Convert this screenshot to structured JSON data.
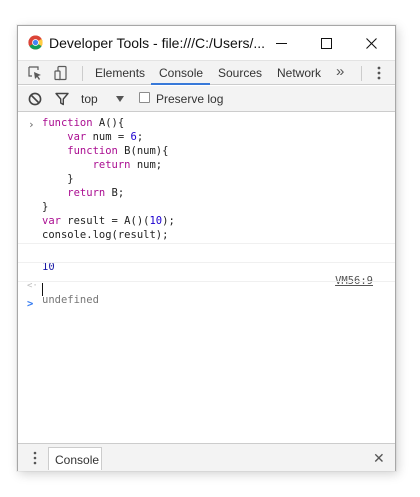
{
  "window": {
    "title": "Developer Tools - file:///C:/Users/...",
    "controls": {
      "minimize": "—",
      "maximize": "☐",
      "close": "✕"
    }
  },
  "tabs": {
    "items": [
      {
        "label": "Elements",
        "active": false
      },
      {
        "label": "Console",
        "active": true
      },
      {
        "label": "Sources",
        "active": false
      },
      {
        "label": "Network",
        "active": false
      }
    ],
    "more_label": "»"
  },
  "filter": {
    "context": "top",
    "preserve_log": "Preserve log"
  },
  "console": {
    "input_code": [
      [
        [
          "kw",
          "function"
        ],
        [
          "plain",
          " A(){"
        ]
      ],
      [
        [
          "kw",
          "    var"
        ],
        [
          "plain",
          " num = "
        ],
        [
          "num",
          "6"
        ],
        [
          "plain",
          ";"
        ]
      ],
      [
        [
          "kw",
          "    function"
        ],
        [
          "plain",
          " B(num){"
        ]
      ],
      [
        [
          "kw",
          "        return"
        ],
        [
          "plain",
          " num;"
        ]
      ],
      [
        [
          "plain",
          "    }"
        ]
      ],
      [
        [
          "kw",
          "    return"
        ],
        [
          "plain",
          " B;"
        ]
      ],
      [
        [
          "plain",
          "}"
        ]
      ],
      [
        [
          "kw",
          "var"
        ],
        [
          "plain",
          " result = A()("
        ],
        [
          "num",
          "10"
        ],
        [
          "plain",
          ");"
        ]
      ],
      [
        [
          "plain",
          "console.log(result);"
        ]
      ]
    ],
    "log_output": "10",
    "log_source": "VM56:9",
    "return_value": "undefined",
    "prompt_symbol": ">",
    "result_symbol": "<·"
  },
  "drawer": {
    "tab_label": "Console",
    "close": "✕"
  },
  "colors": {
    "accent": "#3879d9",
    "keyword": "#aa0d91",
    "number": "#1c00cf",
    "prompt": "#367cf1"
  }
}
